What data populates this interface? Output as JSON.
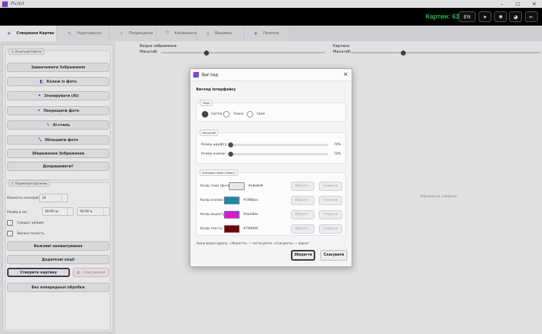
{
  "app": {
    "title": "PicArt"
  },
  "header": {
    "counter": "Картин: 63",
    "lang": "EN"
  },
  "tabs": [
    {
      "label": "Створення Картин",
      "icon": "plus-icon"
    },
    {
      "label": "Редагування",
      "icon": "pencil-icon"
    },
    {
      "label": "Покращення",
      "icon": "sparkle-icon"
    },
    {
      "label": "Копіювання",
      "icon": "shield-icon"
    },
    {
      "label": "Вишивка",
      "icon": "thread-icon"
    },
    {
      "label": "Полотно",
      "icon": "puzzle-icon"
    }
  ],
  "left": {
    "group1_title": "1. Початкові Роботи",
    "buttons1": [
      {
        "label": "Завантажити Зображення",
        "icon": ""
      },
      {
        "label": "Колаж із фото",
        "icon": "◧"
      },
      {
        "label": "Згенерувати (AI)",
        "icon": "✦"
      },
      {
        "label": "Покращити фото",
        "icon": "✦"
      },
      {
        "label": "AI-стиль",
        "icon": "✎"
      },
      {
        "label": "Збільшити фото",
        "icon": "⤡"
      },
      {
        "label": "Збереження Зображення",
        "icon": ""
      },
      {
        "label": "Допрацювати?",
        "icon": ""
      }
    ],
    "group2_title": "2. Параметри картинки",
    "colors_label": "Кількість кольорів:",
    "colors_value": "24",
    "size_label": "Розмір в см:",
    "size_w": "40.00 ш.",
    "size_h": "50.00 в.",
    "check1": "Сувора і режим",
    "check2": "Висока точність",
    "buttons2": [
      {
        "label": "Важливі налаштування"
      },
      {
        "label": "Додаткові опції"
      }
    ],
    "create_label": "Створити картину",
    "cancel_label": "Скасування",
    "noprep_label": "Без попередньої обробки"
  },
  "center": {
    "left_title": "Вхідне зображення:",
    "left_scale": "Масштаб:",
    "right_title": "Картина:",
    "right_scale": "Масштаб:",
    "placeholder": "Картина не створена",
    "left_zoom": 0.27,
    "right_zoom": 0.27
  },
  "dialog": {
    "title": "Вигляд",
    "section": "Вигляд інтерфейсу",
    "theme_tag": "Тема",
    "themes": [
      "Світла",
      "Темна",
      "Своя"
    ],
    "theme_selected": 0,
    "scale_tag": "Масштаб",
    "font_label": "Розмір шрифту:",
    "font_value": "70%",
    "font_level": 0.0,
    "button_label": "Розмір кнопок:",
    "button_value": "70%",
    "button_level": 0.0,
    "colors_tag": "Кольори (тема «Своя»)",
    "colors": [
      {
        "label": "Колір теми (фон):",
        "hex": "#e8e8e8",
        "color": "#e8e8e8"
      },
      {
        "label": "Колір кнопок:",
        "hex": "#198baa",
        "color": "#198baa"
      },
      {
        "label": "Колір акценту:",
        "hex": "#da18da",
        "color": "#da18da"
      },
      {
        "label": "Колір тексту:",
        "hex": "#790000",
        "color": "#790000"
      }
    ],
    "pick_label": "Обрати...",
    "reset_label": "Скинути",
    "note": "Зміни видно одразу. «Зберегти» — застосувати, «Скасувати» — відкат.",
    "save_label": "Зберегти",
    "cancel_label": "Скасувати"
  },
  "colors": {
    "counter": "#1fcf4a",
    "accent": "#5e4bd8"
  }
}
